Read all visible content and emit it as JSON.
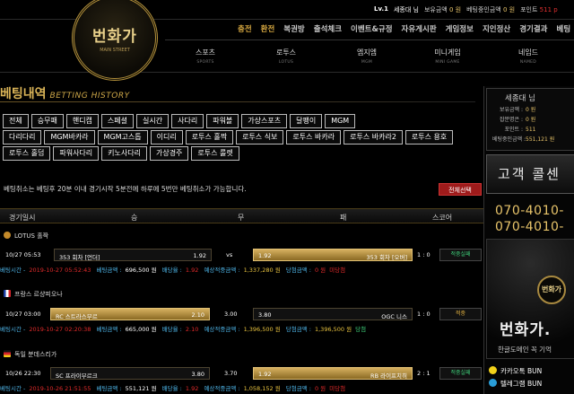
{
  "top": {
    "level": "Lv.1",
    "username": "세종대 님",
    "holding_label": "보유금액",
    "holding_value": "0 원",
    "betting_progress_label": "베팅중인금액",
    "betting_progress_value": "0 원",
    "point_label": "포인트",
    "point_value": "511 p"
  },
  "logo": {
    "text": "번화가",
    "sub": "MAIN STREET"
  },
  "menu_top": [
    "충전",
    "환전",
    "복권방",
    "출석체크",
    "이벤트&규정",
    "자유게시판",
    "게임정보",
    "지인정산",
    "경기결과",
    "베팅"
  ],
  "menu_games": [
    {
      "ko": "스포츠",
      "en": "SPORTS"
    },
    {
      "ko": "로투스",
      "en": "LOTUS"
    },
    {
      "ko": "엠지엠",
      "en": "MGM"
    },
    {
      "ko": "미니게임",
      "en": "MINI GAME"
    },
    {
      "ko": "네임드",
      "en": "NAMED"
    }
  ],
  "page": {
    "title": "베팅내역",
    "title_en": "BETTING HISTORY"
  },
  "filters": [
    [
      "전체",
      "승무패",
      "핸디캡",
      "스페셜",
      "실시간",
      "사다리",
      "파워볼",
      "가상스포츠",
      "달팽이",
      "MGM"
    ],
    [
      "다리다리",
      "MGM바카라",
      "MGM고스톱",
      "이디리",
      "로투스 홀짝",
      "로투스 식보",
      "로투스 바카라",
      "로투스 바카라2",
      "로투스 용호"
    ],
    [
      "로투스 홀덤",
      "파워사다리",
      "키노사다리",
      "가상경주",
      "로투스 룰렛"
    ]
  ],
  "notice": "베팅취소는 베팅후 20분 이내 경기시작 5분전에 하루에 5번만 베팅취소가 가능합니다.",
  "select_all": "전체선택",
  "table_header": {
    "date": "경기일시",
    "win": "승",
    "draw": "무",
    "lose": "패",
    "score": "스코어"
  },
  "labels": {
    "bet_time": "베팅시간 -",
    "bet_amount": "베팅금액 :",
    "odds": "배당율 :",
    "expected": "예상적중금액 :",
    "win_amount": "당첨금액 :"
  },
  "bets": [
    {
      "league": "LOTUS 홀짝",
      "date": "10/27 05:53",
      "home": "353 회차 [언더]",
      "home_odds": "1.92",
      "mid": "vs",
      "away": "353 회차 [오버]",
      "away_odds": "1.92",
      "score": "1 : 0",
      "result": "적중실패",
      "bet_time": "2019-10-27 05:52:43",
      "amount": "696,500 원",
      "odds": "1.92",
      "expected": "1,337,280 원",
      "win": "0 원",
      "status": "미당첨"
    },
    {
      "league": "프랑스 르샹피오나",
      "date": "10/27 03:00",
      "home": "RC 스트라스부르",
      "home_odds": "2.10",
      "mid": "3.00",
      "away": "OGC 니스",
      "away_odds": "3.80",
      "score": "1 : 0",
      "result": "적중",
      "bet_time": "2019-10-27 02:20:38",
      "amount": "665,000 원",
      "odds": "2.10",
      "expected": "1,396,500 원",
      "win": "1,396,500 원",
      "status": "당첨"
    },
    {
      "league": "독일 분데스리가",
      "date": "10/26 22:30",
      "home": "SC 프라이부르크",
      "home_odds": "3.80",
      "mid": "3.70",
      "away": "RB 라이프치히",
      "away_odds": "1.92",
      "score": "2 : 1",
      "result": "적중실패",
      "bet_time": "2019-10-26 21:51:55",
      "amount": "551,121 원",
      "odds": "1.92",
      "expected": "1,058,152 원",
      "win": "0 원",
      "status": "미당첨"
    }
  ],
  "sidebar": {
    "greeting": "세종대 님",
    "rows": [
      {
        "label": "보유금액 :",
        "value": "0 원"
      },
      {
        "label": "잡분명은 :",
        "value": "0 원"
      },
      {
        "label": "포인트 :",
        "value": "511"
      },
      {
        "label": "베팅중인금액 :",
        "value": "551,121 원"
      }
    ],
    "cs_title": "고객 콜센",
    "phone1": "070-4010-",
    "phone2": "070-4010-",
    "banner_logo": "번화가",
    "banner_title": "번화가.",
    "banner_sub": "한글도메인 꼭 기억",
    "links": [
      {
        "icon": "kakao-icon",
        "label": "카카오톡",
        "value": "BUN"
      },
      {
        "icon": "telegram-icon",
        "label": "텔레그램",
        "value": "BUN"
      }
    ]
  },
  "colors": {
    "gold": "#d4a640",
    "red": "#e02a2a",
    "blue": "#4db3e6",
    "green": "#3fd07a"
  }
}
